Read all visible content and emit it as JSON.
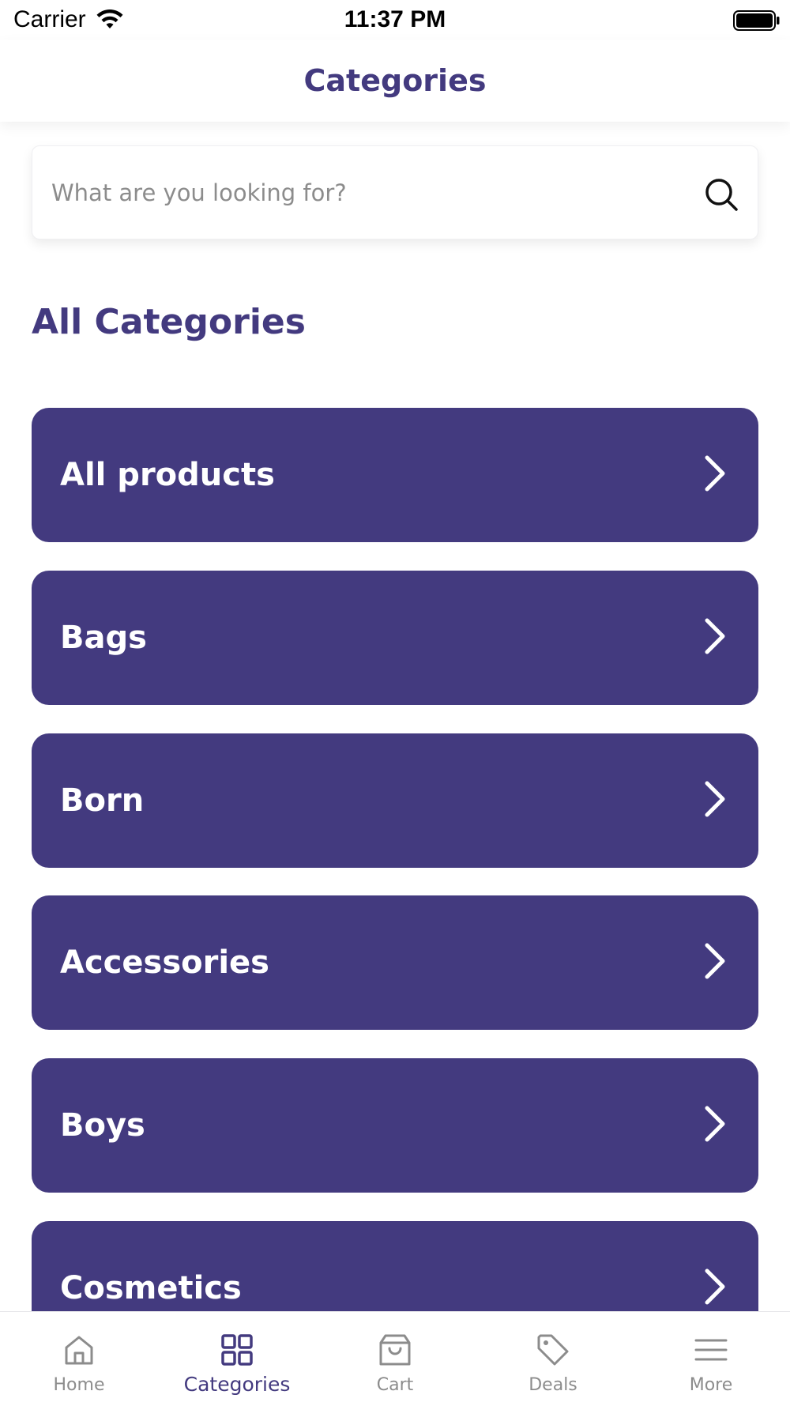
{
  "status_bar": {
    "carrier": "Carrier",
    "time": "11:37 PM"
  },
  "header": {
    "title": "Categories"
  },
  "search": {
    "placeholder": "What are you looking for?",
    "value": ""
  },
  "section": {
    "title": "All Categories"
  },
  "categories": [
    {
      "label": "All products"
    },
    {
      "label": "Bags"
    },
    {
      "label": "Born"
    },
    {
      "label": "Accessories"
    },
    {
      "label": "Boys"
    },
    {
      "label": "Cosmetics"
    }
  ],
  "tab_bar": {
    "items": [
      {
        "label": "Home",
        "icon": "home-icon",
        "active": false
      },
      {
        "label": "Categories",
        "icon": "grid-icon",
        "active": true
      },
      {
        "label": "Cart",
        "icon": "shopping-bag-icon",
        "active": false
      },
      {
        "label": "Deals",
        "icon": "tag-icon",
        "active": false
      },
      {
        "label": "More",
        "icon": "menu-icon",
        "active": false
      }
    ]
  },
  "colors": {
    "brand": "#433a7f",
    "inactive": "#8c8c8c",
    "card_text": "#ffffff"
  }
}
